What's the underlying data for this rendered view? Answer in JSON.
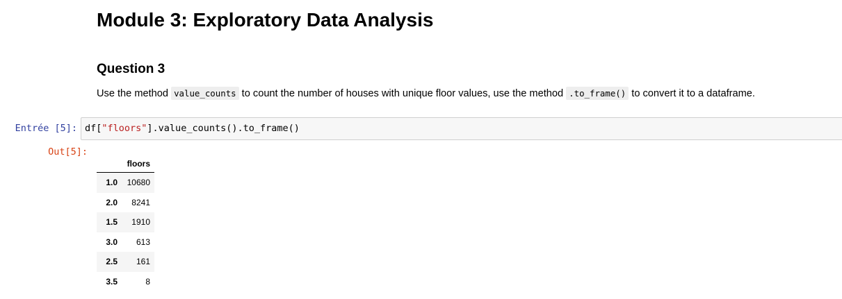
{
  "markdown": {
    "title": "Module 3: Exploratory Data Analysis",
    "subtitle": "Question 3",
    "paragraph": {
      "part1": "Use the method ",
      "code1": "value_counts",
      "part2": " to count the number of houses with unique floor values, use the method ",
      "code2": ".to_frame()",
      "part3": " to convert it to a dataframe."
    }
  },
  "input_cell": {
    "prompt": "Entrée [5]:",
    "code_prefix": "df[",
    "code_string": "\"floors\"",
    "code_suffix": "].value_counts().to_frame()"
  },
  "output_cell": {
    "prompt": "Out[5]:",
    "table": {
      "column_header": "floors",
      "rows": [
        {
          "index": "1.0",
          "value": "10680"
        },
        {
          "index": "2.0",
          "value": "8241"
        },
        {
          "index": "1.5",
          "value": "1910"
        },
        {
          "index": "3.0",
          "value": "613"
        },
        {
          "index": "2.5",
          "value": "161"
        },
        {
          "index": "3.5",
          "value": "8"
        }
      ]
    }
  },
  "colors": {
    "in_prompt": "#303f9f",
    "out_prompt": "#d84315",
    "string": "#ba2121",
    "cell_background": "#f7f7f7"
  }
}
